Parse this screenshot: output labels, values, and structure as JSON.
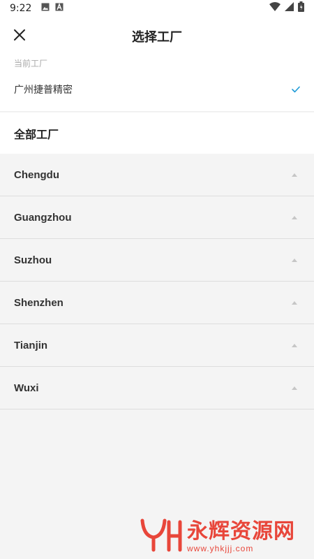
{
  "status_bar": {
    "time": "9:22",
    "icons_left": [
      "image-icon",
      "font-icon"
    ],
    "icons_right": [
      "wifi-icon",
      "cell-signal-icon",
      "battery-icon"
    ]
  },
  "header": {
    "title": "选择工厂",
    "close_icon": "close-icon"
  },
  "current": {
    "label": "当前工厂",
    "factory_name": "广州捷普精密",
    "selected_icon": "check-icon"
  },
  "all": {
    "label": "全部工厂"
  },
  "cities": [
    {
      "name": "Chengdu"
    },
    {
      "name": "Guangzhou"
    },
    {
      "name": "Suzhou"
    },
    {
      "name": "Shenzhen"
    },
    {
      "name": "Tianjin"
    },
    {
      "name": "Wuxi"
    }
  ],
  "watermark": {
    "title": "永辉资源网",
    "url": "www.yhkjjj.com"
  },
  "colors": {
    "accent": "#1e9bd7",
    "watermark": "#e8463a",
    "background": "#f4f4f4"
  }
}
